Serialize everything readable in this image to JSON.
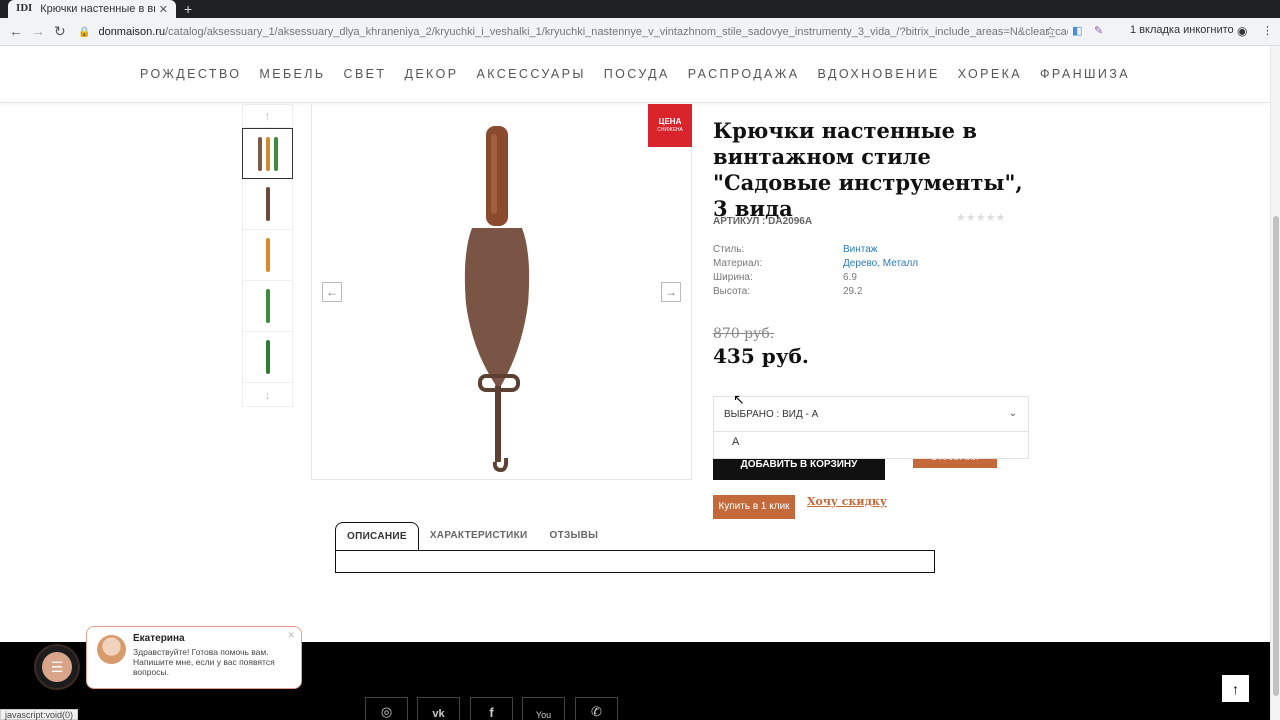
{
  "browser": {
    "tab_title": "Крючки настенные в вин",
    "tab_favicon": "IDI",
    "new_tab": "+",
    "url_host": "donmaison.ru",
    "url_path": "/catalog/aksessuary_1/aksessuary_dlya_khraneniya_2/kryuchki_i_veshalki_1/kryuchki_nastennye_v_vintazhnom_stile_sadovye_instrumenty_3_vida_/?bitrix_include_areas=N&clear_cache=Y",
    "incognito_label": "1 вкладка инкогнито",
    "status_url": "javascript:void(0)"
  },
  "menu": [
    "РОЖДЕСТВО",
    "МЕБЕЛЬ",
    "СВЕТ",
    "ДЕКОР",
    "АКСЕССУАРЫ",
    "ПОСУДА",
    "РАСПРОДАЖА",
    "ВДОХНОВЕНИЕ",
    "ХОРЕКА",
    "ФРАНШИЗА"
  ],
  "gallery": {
    "badge": "ЦЕНА",
    "badge_sub": "СНИЖЕНА",
    "thumb_count": 5
  },
  "product": {
    "title": "Крючки настенные в винтажном стиле \"Садовые инструменты\", 3 вида",
    "sku": "АРТИКУЛ : DA2096A",
    "props": [
      {
        "k": "Стиль:",
        "v": "Винтаж",
        "link": true
      },
      {
        "k": "Материал:",
        "v": "Дерево, Металл",
        "link": true
      },
      {
        "k": "Ширина:",
        "v": "6.9",
        "link": false
      },
      {
        "k": "Высота:",
        "v": "29.2",
        "link": false
      }
    ],
    "rating": "★★★★★",
    "old_price": "870 руб.",
    "price": "435 руб.",
    "selected": "ВЫБРАНО : ВИД - А",
    "dropdown_option": "А",
    "add_to_cart": "ДОБАВИТЬ В КОРЗИНУ",
    "in_stock": "В НАЛИЧИИ",
    "buy_one_click": "Купить в 1 клик",
    "want_discount": "Хочу скидку"
  },
  "tabs": [
    "ОПИСАНИЕ",
    "ХАРАКТЕРИСТИКИ",
    "ОТЗЫВЫ"
  ],
  "chat": {
    "name": "Екатерина",
    "message": "Здравствуйте! Готова помочь вам. Напишите мне, если у вас появятся вопросы."
  },
  "colors": {
    "accent": "#c46a3a",
    "badge": "#d9242c",
    "link": "#2b7bb9"
  }
}
